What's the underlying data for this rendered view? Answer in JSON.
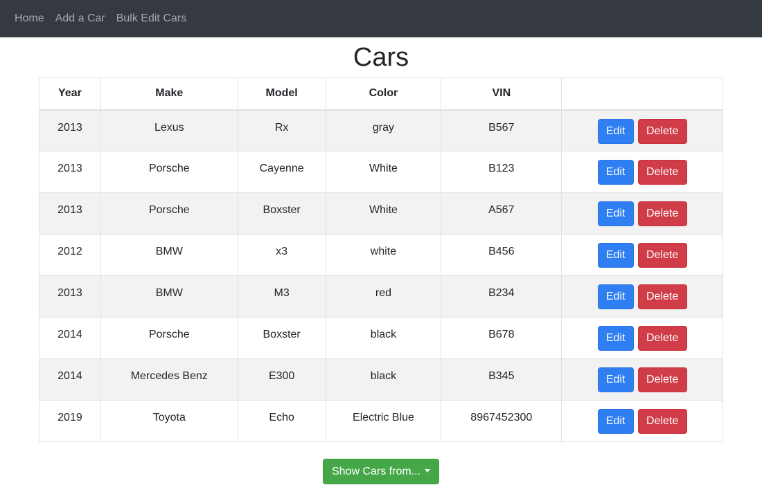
{
  "nav": {
    "items": [
      {
        "label": "Home"
      },
      {
        "label": "Add a Car"
      },
      {
        "label": "Bulk Edit Cars"
      }
    ]
  },
  "page": {
    "title": "Cars"
  },
  "table": {
    "headers": [
      "Year",
      "Make",
      "Model",
      "Color",
      "VIN",
      ""
    ],
    "rows": [
      {
        "year": "2013",
        "make": "Lexus",
        "model": "Rx",
        "color": "gray",
        "vin": "B567"
      },
      {
        "year": "2013",
        "make": "Porsche",
        "model": "Cayenne",
        "color": "White",
        "vin": "B123"
      },
      {
        "year": "2013",
        "make": "Porsche",
        "model": "Boxster",
        "color": "White",
        "vin": "A567"
      },
      {
        "year": "2012",
        "make": "BMW",
        "model": "x3",
        "color": "white",
        "vin": "B456"
      },
      {
        "year": "2013",
        "make": "BMW",
        "model": "M3",
        "color": "red",
        "vin": "B234"
      },
      {
        "year": "2014",
        "make": "Porsche",
        "model": "Boxster",
        "color": "black",
        "vin": "B678"
      },
      {
        "year": "2014",
        "make": "Mercedes Benz",
        "model": "E300",
        "color": "black",
        "vin": "B345"
      },
      {
        "year": "2019",
        "make": "Toyota",
        "model": "Echo",
        "color": "Electric Blue",
        "vin": "8967452300"
      }
    ],
    "edit_label": "Edit",
    "delete_label": "Delete"
  },
  "filter": {
    "label": "Show Cars from...",
    "icon": "caret-down-icon"
  },
  "colors": {
    "navbar": "#343a40",
    "edit": "#2f7ff3",
    "delete": "#d03c47",
    "show": "#45a747"
  }
}
